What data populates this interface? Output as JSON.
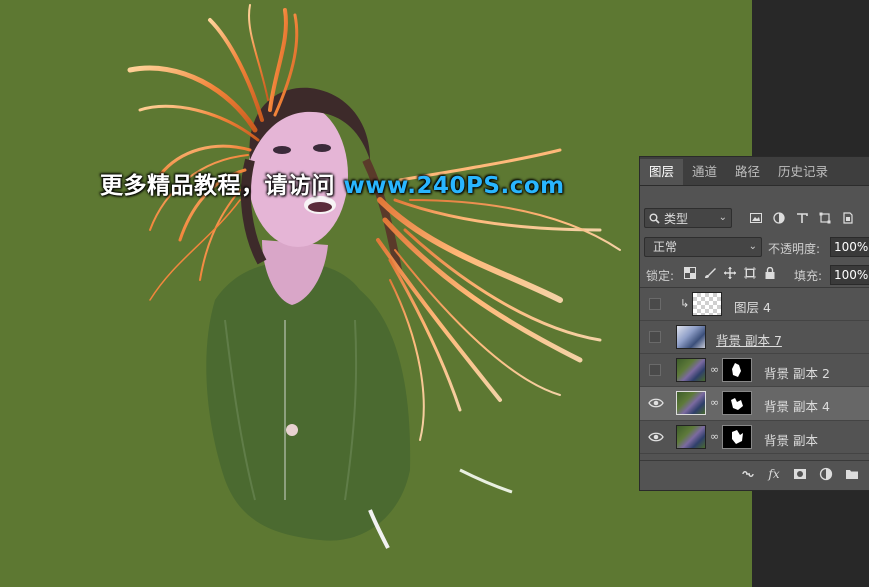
{
  "watermark": {
    "text": "更多精品教程，请访问 ",
    "url": "www.240PS.com"
  },
  "panel": {
    "tabs": [
      {
        "label": "图层",
        "active": true
      },
      {
        "label": "通道",
        "active": false
      },
      {
        "label": "路径",
        "active": false
      },
      {
        "label": "历史记录",
        "active": false
      }
    ],
    "filter": {
      "label": "类型",
      "icon": "search-icon"
    },
    "filter_icons": [
      "image-filter-icon",
      "adjustment-filter-icon",
      "type-filter-icon",
      "shape-filter-icon",
      "smart-object-filter-icon"
    ],
    "blend_mode": "正常",
    "opacity_label": "不透明度:",
    "opacity_value": "100%",
    "lock_label": "锁定:",
    "lock_icons": [
      "lock-transparent-icon",
      "lock-paint-icon",
      "lock-move-icon",
      "lock-artboard-icon",
      "lock-all-icon"
    ],
    "fill_label": "填充:",
    "fill_value": "100%",
    "layers": [
      {
        "name": "图层 4",
        "visible": false,
        "clipped": true,
        "thumb": "transparent",
        "mask": false,
        "selected": false
      },
      {
        "name": "背景 副本 7",
        "visible": false,
        "clipped": false,
        "thumb": "photo2",
        "mask": false,
        "selected": false
      },
      {
        "name": "背景 副本 2",
        "visible": false,
        "clipped": false,
        "thumb": "photo",
        "mask": true,
        "selected": false
      },
      {
        "name": "背景 副本 4",
        "visible": true,
        "clipped": false,
        "thumb": "photo",
        "mask": true,
        "selected": true
      },
      {
        "name": "背景 副本",
        "visible": true,
        "clipped": false,
        "thumb": "photo",
        "mask": true,
        "selected": false
      }
    ],
    "bottom_icons": [
      "link-layers-icon",
      "fx-icon",
      "add-mask-icon",
      "adjustment-layer-icon",
      "new-group-icon"
    ]
  },
  "colors": {
    "canvas_bg": "#5d7832",
    "pasteboard": "#282828",
    "panel_bg": "#535353",
    "url_color": "#29b6ff"
  }
}
